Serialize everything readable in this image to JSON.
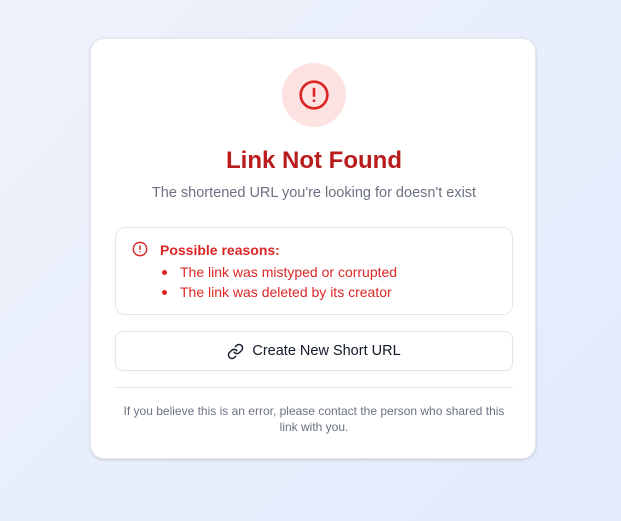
{
  "card": {
    "title": "Link Not Found",
    "subtitle": "The shortened URL you're looking for doesn't exist",
    "main_icon": "alert-circle-icon"
  },
  "reasons": {
    "icon": "alert-circle-icon",
    "title": "Possible reasons:",
    "items": [
      "The link was mistyped or corrupted",
      "The link was deleted by its creator"
    ]
  },
  "create_button": {
    "icon": "link-icon",
    "label": "Create New Short URL"
  },
  "footer": {
    "note": "If you believe this is an error, please contact the person who shared this link with you."
  },
  "colors": {
    "error_red": "#dc2626",
    "title_red": "#b91c1c",
    "icon_bg": "#fde2e2"
  }
}
